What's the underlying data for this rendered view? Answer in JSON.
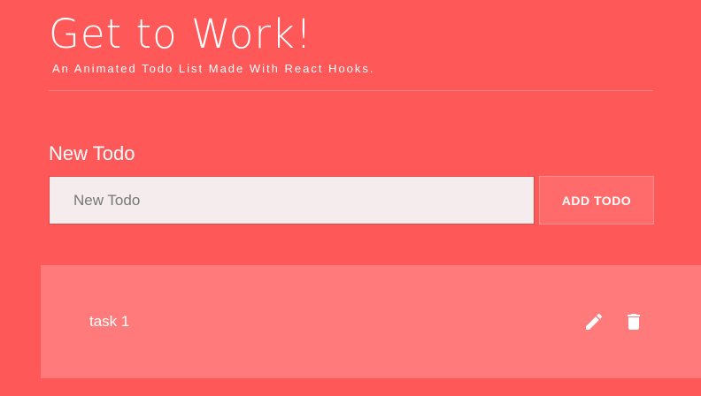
{
  "header": {
    "title": "Get to Work!",
    "subtitle": "An Animated Todo List Made With React Hooks."
  },
  "form": {
    "label": "New Todo",
    "input_placeholder": "New Todo",
    "input_value": "",
    "submit_label": "ADD TODO"
  },
  "todos": [
    {
      "text": "task 1",
      "edit_icon": "pencil-icon",
      "delete_icon": "trash-icon"
    }
  ],
  "colors": {
    "background": "#fe5858",
    "todo_item_background": "#ff7a7a",
    "input_background": "#f5eded"
  }
}
